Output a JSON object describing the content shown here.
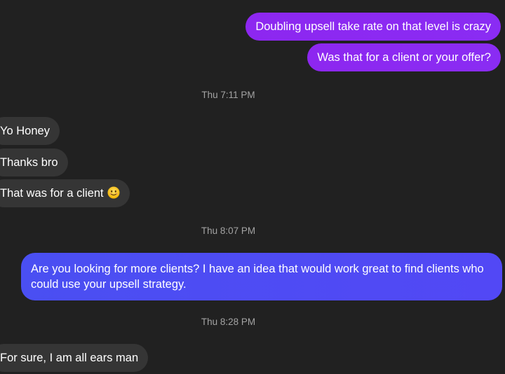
{
  "messages": {
    "out1": "Doubling upsell take rate on that level is crazy",
    "out2": "Was that for a client or your offer?",
    "ts1": "Thu 7:11 PM",
    "in1": "Yo Honey",
    "in2": "Thanks bro",
    "in3": "That was for a client",
    "in3_emoji": "smiling-face-icon",
    "ts2": "Thu 8:07 PM",
    "out3": "Are you looking for more clients? I have an idea that would work great to find clients who could use your upsell strategy.",
    "ts3": "Thu 8:28 PM",
    "in4": "For sure, I am all ears man"
  },
  "colors": {
    "background": "#212121",
    "outgoing_purple": "#8a2cf3",
    "outgoing_blue": "#4f4bf3",
    "incoming_gray": "#353535",
    "timestamp": "#a3a3a3"
  }
}
